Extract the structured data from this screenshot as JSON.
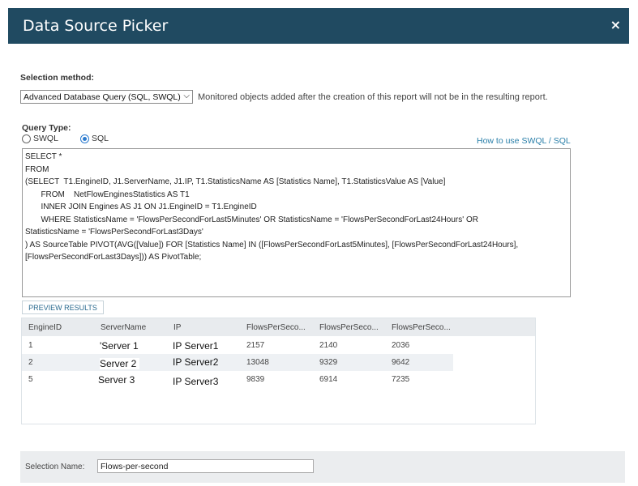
{
  "dialog": {
    "title": "Data Source Picker",
    "close_glyph": "×"
  },
  "selection_method": {
    "label": "Selection method:",
    "selected": "Advanced Database Query (SQL, SWQL)",
    "note": "Monitored objects added after the creation of this report will not be in the resulting report."
  },
  "query_type": {
    "label": "Query Type:",
    "options": [
      {
        "label": "SWQL",
        "selected": false
      },
      {
        "label": "SQL",
        "selected": true
      }
    ],
    "help_link": "How to use SWQL / SQL"
  },
  "query_text": "SELECT *\nFROM\n(SELECT  T1.EngineID, J1.ServerName, J1.IP, T1.StatisticsName AS [Statistics Name], T1.StatisticsValue AS [Value]\n       FROM    NetFlowEnginesStatistics AS T1\n       INNER JOIN Engines AS J1 ON J1.EngineID = T1.EngineID\n       WHERE StatisticsName = 'FlowsPerSecondForLast5Minutes' OR StatisticsName = 'FlowsPerSecondForLast24Hours' OR\nStatisticsName = 'FlowsPerSecondForLast3Days'\n) AS SourceTable PIVOT(AVG([Value]) FOR [Statistics Name] IN ([FlowsPerSecondForLast5Minutes], [FlowsPerSecondForLast24Hours],\n[FlowsPerSecondForLast3Days])) AS PivotTable;",
  "preview_button": "PREVIEW RESULTS",
  "results": {
    "columns": [
      "EngineID",
      "ServerName",
      "IP",
      "FlowsPerSeco...",
      "FlowsPerSeco...",
      "FlowsPerSeco..."
    ],
    "rows": [
      [
        "1",
        "'Server 1",
        "IP Server1",
        "2157",
        "2140",
        "2036"
      ],
      [
        "2",
        "Server 2",
        "IP Server2",
        "13048",
        "9329",
        "9642"
      ],
      [
        "5",
        "Server 3",
        "IP Server3",
        "9839",
        "6914",
        "7235"
      ]
    ]
  },
  "selection_name": {
    "label": "Selection Name:",
    "value": "Flows-per-second"
  },
  "colors": {
    "header": "#204a61",
    "accent": "#2c7bcf",
    "link": "#2a7fa9"
  }
}
